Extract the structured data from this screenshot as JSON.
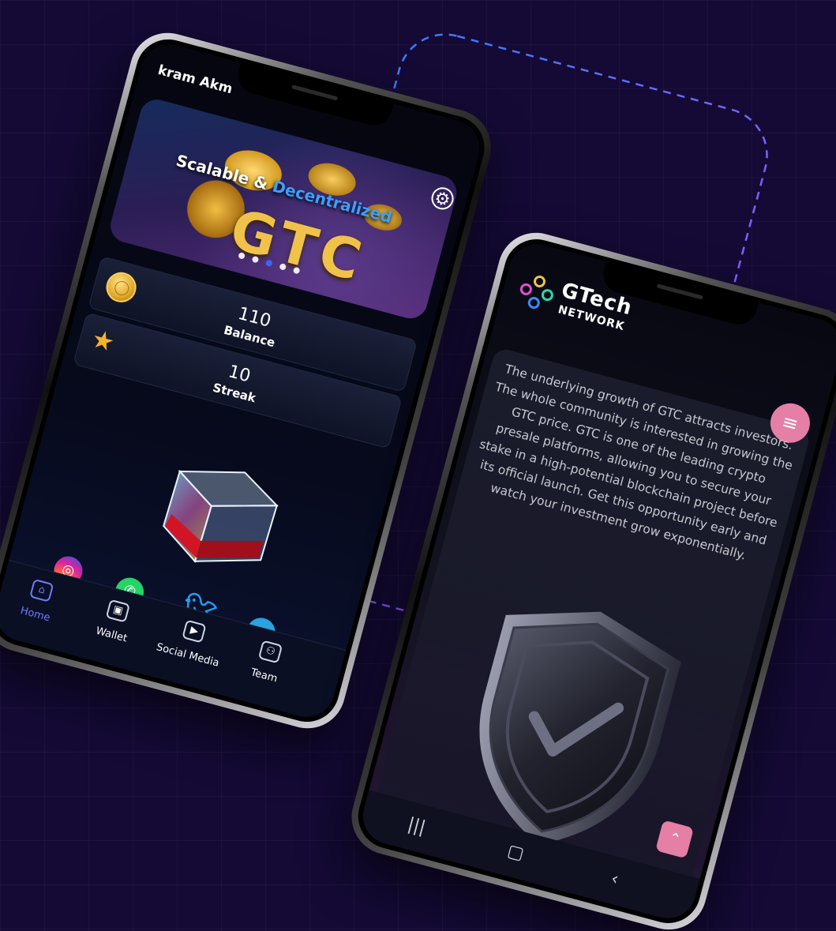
{
  "phone1": {
    "user_name": "kram Akm",
    "settings_icon": "gear-icon",
    "banner": {
      "line1_a": "Scalable & ",
      "line1_b": "Decentralized",
      "big_text": "GTC",
      "slide_count": 5,
      "active_slide": 3
    },
    "stats": [
      {
        "value": "110",
        "label": "Balance",
        "icon": "coin-icon"
      },
      {
        "value": "10",
        "label": "Streak",
        "icon": "star-icon"
      }
    ],
    "socials": [
      {
        "name": "instagram-icon"
      },
      {
        "name": "whatsapp-icon"
      },
      {
        "name": "twitter-icon"
      },
      {
        "name": "telegram-icon"
      }
    ],
    "nav": [
      {
        "label": "Home",
        "icon": "home-icon",
        "active": true
      },
      {
        "label": "Wallet",
        "icon": "wallet-icon",
        "active": false
      },
      {
        "label": "Social Media",
        "icon": "media-icon",
        "active": false
      },
      {
        "label": "Team",
        "icon": "team-icon",
        "active": false
      }
    ]
  },
  "phone2": {
    "logo_title": "GTech",
    "logo_sub": "NETWORK",
    "menu_icon": "hamburger-icon",
    "description": "The underlying growth of GTC attracts investors. The whole community is interested in growing the GTC price. GTC is one of the leading crypto presale platforms, allowing you to secure your stake in a high-potential blockchain project before its official launch. Get this opportunity early and watch your investment grow exponentially.",
    "scroll_top_icon": "chevron-up-icon",
    "system_nav": [
      "recents-icon",
      "home-circle-icon",
      "back-icon"
    ]
  },
  "colors": {
    "background": "#140a35",
    "accent_pink": "#e57fa6",
    "accent_blue": "#6d7cff",
    "gold": "#f0c24a"
  }
}
